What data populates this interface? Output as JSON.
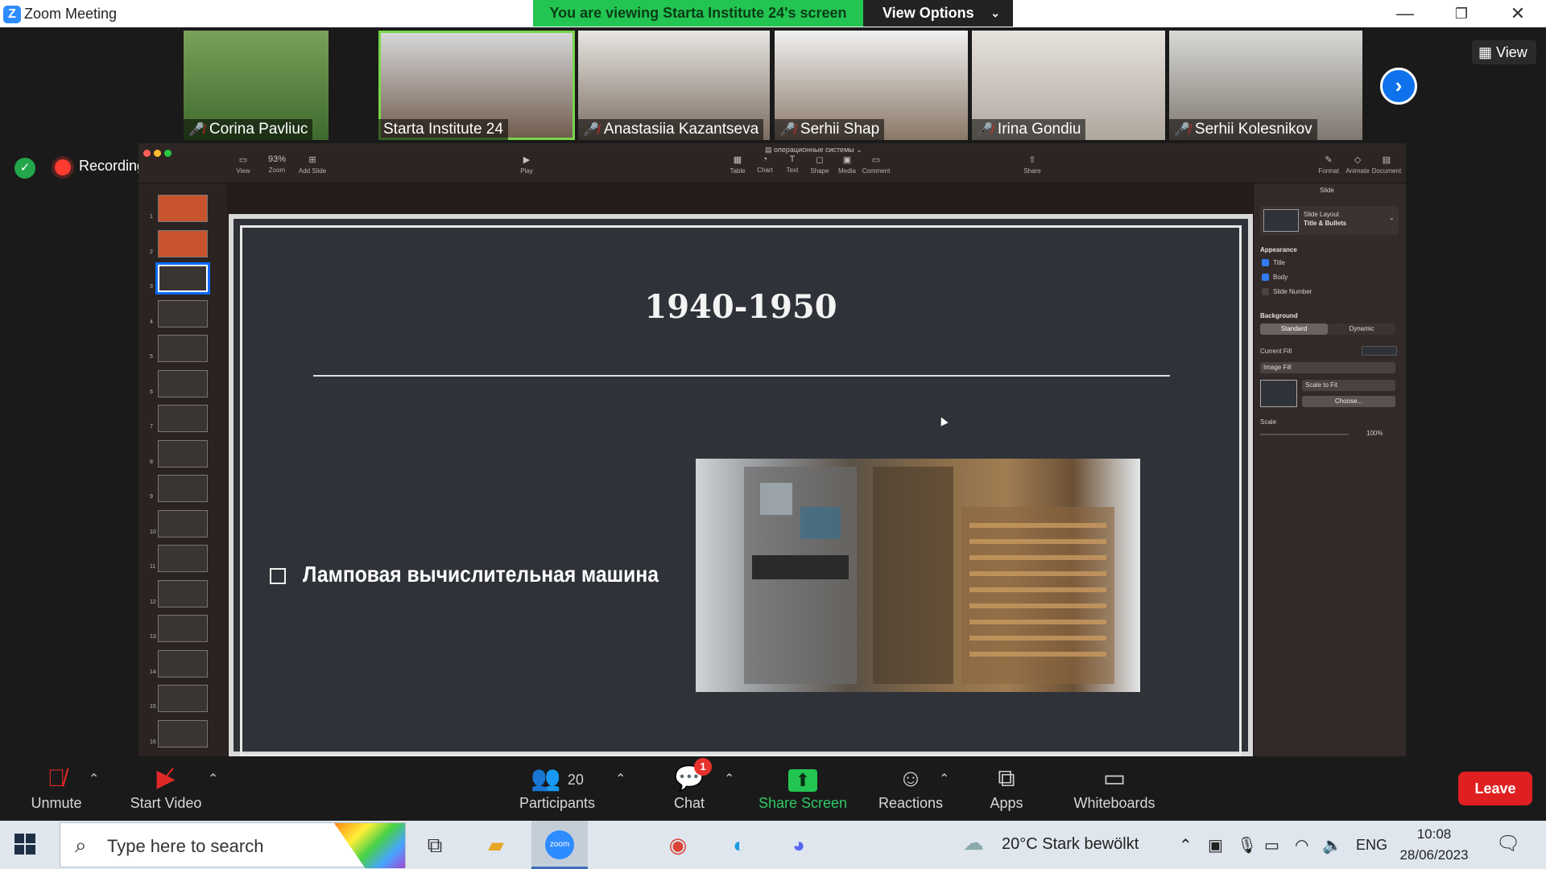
{
  "window": {
    "title": "Zoom Meeting"
  },
  "banner": {
    "viewing": "You are viewing Starta Institute 24's screen",
    "view_options": "View Options"
  },
  "gallery": {
    "view_label": "View",
    "participants": [
      {
        "name": "Corina Pavliuc",
        "muted": true
      },
      {
        "name": "Starta Institute 24",
        "muted": false,
        "active": true
      },
      {
        "name": "Anastasiia Kazantseva",
        "muted": true
      },
      {
        "name": "Serhii Shap",
        "muted": true
      },
      {
        "name": "Irina Gondiu",
        "muted": true
      },
      {
        "name": "Serhii Kolesnikov",
        "muted": true
      }
    ]
  },
  "recording": {
    "label": "Recording"
  },
  "keynote": {
    "doc_title": "операционные системы",
    "toolbar": {
      "view": "View",
      "zoom": "Zoom",
      "zoom_value": "93%",
      "add_slide": "Add Slide",
      "play": "Play",
      "table": "Table",
      "chart": "Chart",
      "text": "Text",
      "shape": "Shape",
      "media": "Media",
      "comment": "Comment",
      "share": "Share",
      "format": "Format",
      "animate": "Animate",
      "document": "Document"
    },
    "slide_numbers": [
      "1",
      "2",
      "3",
      "4",
      "5",
      "6",
      "7",
      "8",
      "9",
      "10",
      "11",
      "12",
      "13",
      "14",
      "15",
      "16"
    ],
    "selected_slide": 3,
    "slide": {
      "title": "1940-1950",
      "bullet": "Ламповая вычислительная машина"
    },
    "inspector": {
      "tab": "Slide",
      "layout_label": "Slide Layout",
      "layout_value": "Title & Bullets",
      "appearance": "Appearance",
      "title_chk": "Title",
      "body_chk": "Body",
      "number_chk": "Slide Number",
      "background": "Background",
      "standard": "Standard",
      "dynamic": "Dynamic",
      "current_fill": "Current Fill",
      "image_fill": "Image Fill",
      "scale_to_fit": "Scale to Fit",
      "choose": "Choose...",
      "scale": "Scale",
      "scale_value": "100%"
    }
  },
  "controls": {
    "unmute": "Unmute",
    "start_video": "Start Video",
    "participants_count": "20",
    "participants": "Participants",
    "chat": "Chat",
    "chat_badge": "1",
    "share_screen": "Share Screen",
    "reactions": "Reactions",
    "apps": "Apps",
    "whiteboards": "Whiteboards",
    "leave": "Leave"
  },
  "taskbar": {
    "search_placeholder": "Type here to search",
    "zoom_icon": "zoom",
    "weather": "20°C  Stark bewölkt",
    "language": "ENG",
    "time": "10:08",
    "date": "28/06/2023"
  }
}
